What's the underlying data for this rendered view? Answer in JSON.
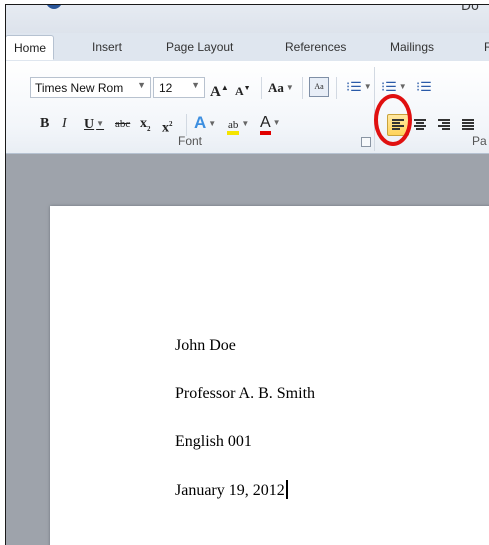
{
  "window": {
    "title_fragment": "Do"
  },
  "tabs": [
    {
      "label": "Home",
      "active": true
    },
    {
      "label": "Insert",
      "active": false
    },
    {
      "label": "Page Layout",
      "active": false
    },
    {
      "label": "References",
      "active": false
    },
    {
      "label": "Mailings",
      "active": false
    },
    {
      "label": "R",
      "active": false
    }
  ],
  "font_group": {
    "font_name": "Times New Rom",
    "font_size": "12",
    "grow_font": "A",
    "shrink_font": "A",
    "change_case": "Aa",
    "bold": "B",
    "italic": "I",
    "underline": "U",
    "strikethrough": "abc",
    "subscript": "x",
    "superscript": "x",
    "text_effects": "A",
    "highlight": "ab",
    "font_color": "A",
    "label": "Font"
  },
  "paragraph_group": {
    "label": "Pa"
  },
  "document": {
    "lines": [
      "John Doe",
      "Professor A. B. Smith",
      "English 001",
      "January 19, 2012"
    ]
  },
  "colors": {
    "highlight_ring": "#e01010",
    "active_button": "#ffd35a",
    "workspace": "#9ea3ab"
  }
}
